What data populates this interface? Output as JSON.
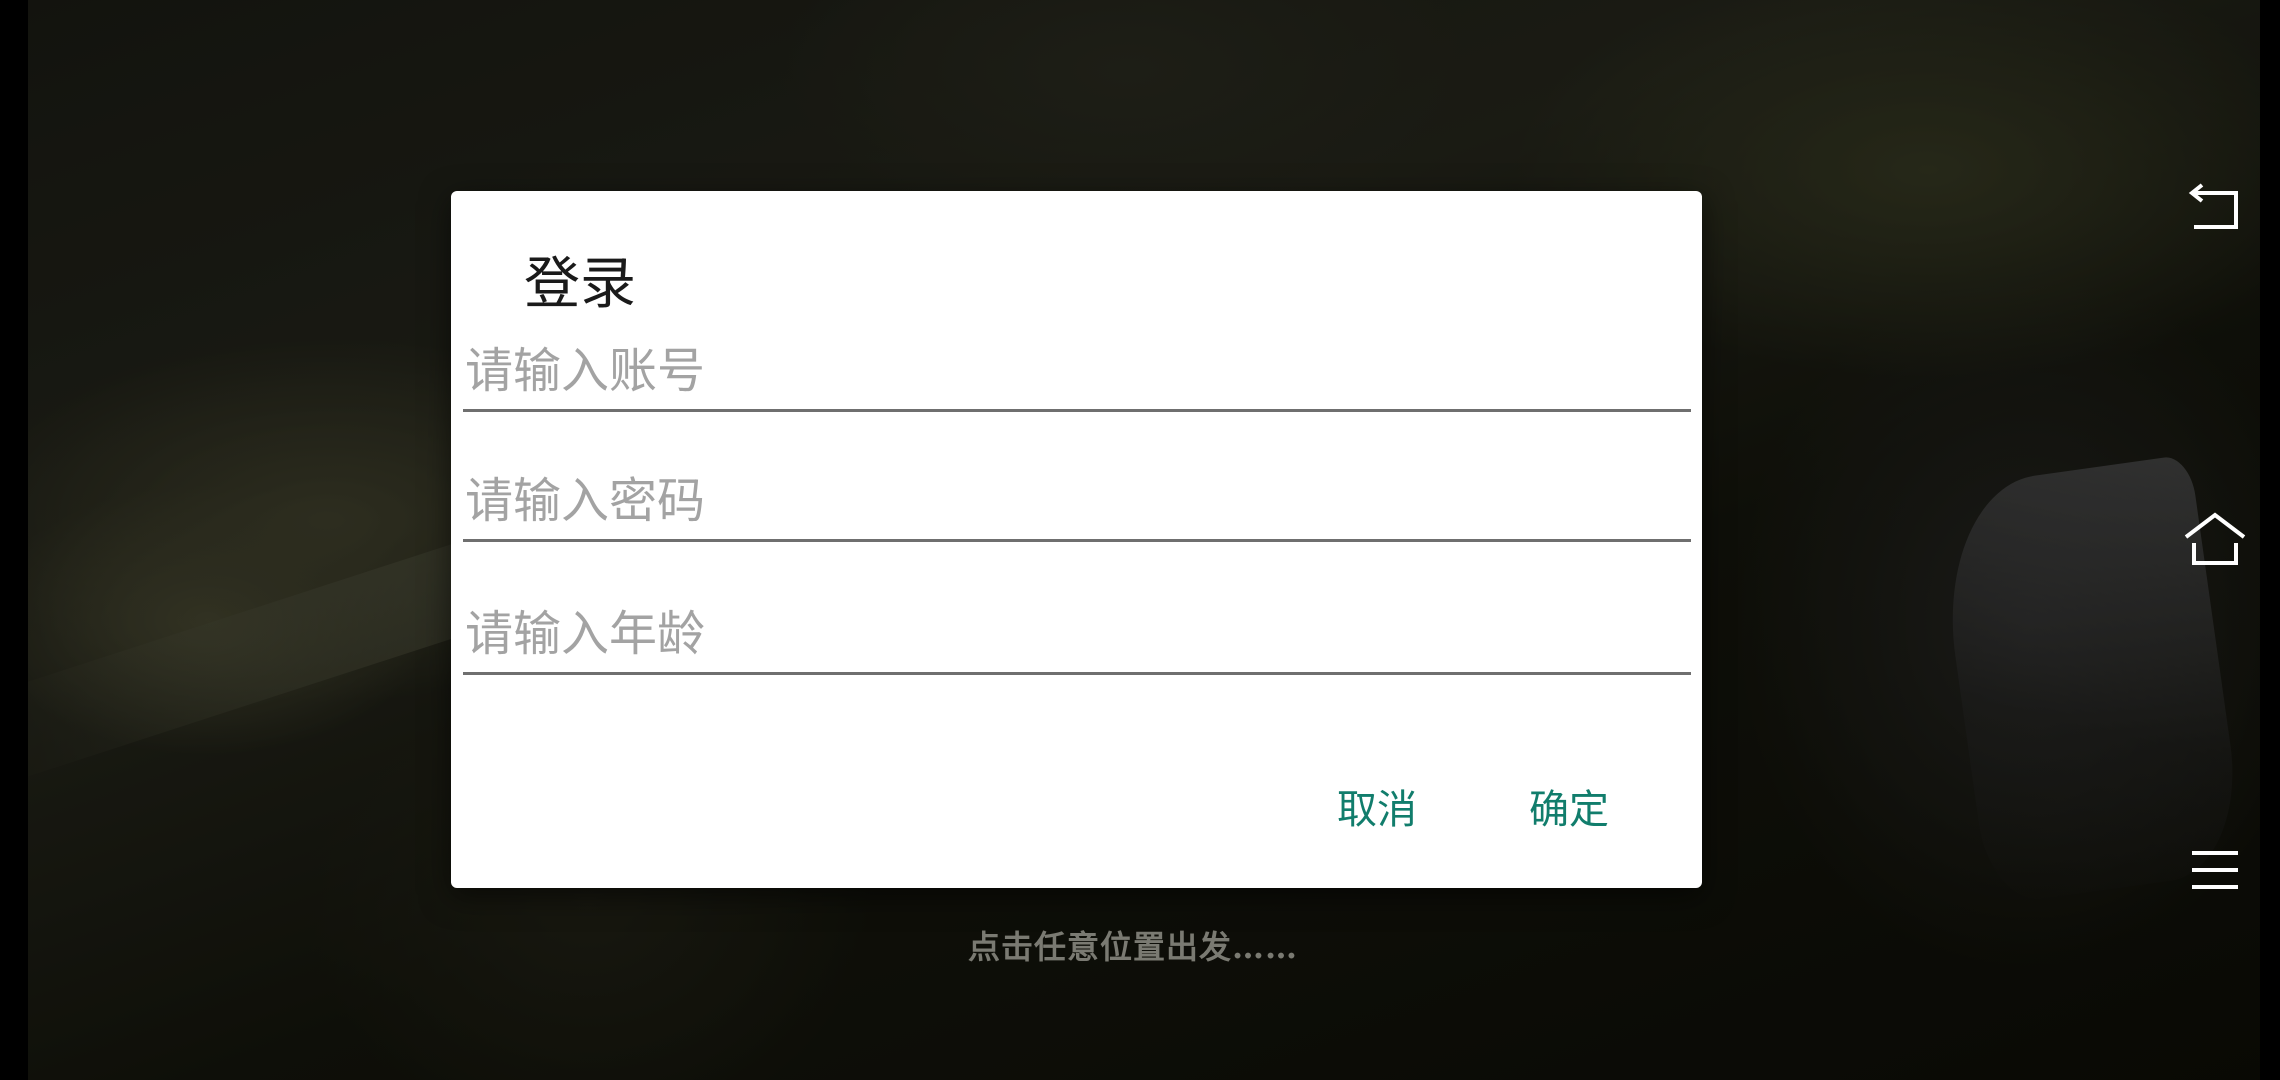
{
  "dialog": {
    "title": "登录",
    "fields": [
      {
        "placeholder": "请输入账号",
        "value": ""
      },
      {
        "placeholder": "请输入密码",
        "value": ""
      },
      {
        "placeholder": "请输入年龄",
        "value": ""
      }
    ],
    "cancel_label": "取消",
    "confirm_label": "确定",
    "accent_color": "#117d6c"
  },
  "background": {
    "hint_text": "点击任意位置出发……"
  },
  "nav": {
    "icons": [
      "back-icon",
      "home-icon",
      "menu-icon"
    ]
  }
}
